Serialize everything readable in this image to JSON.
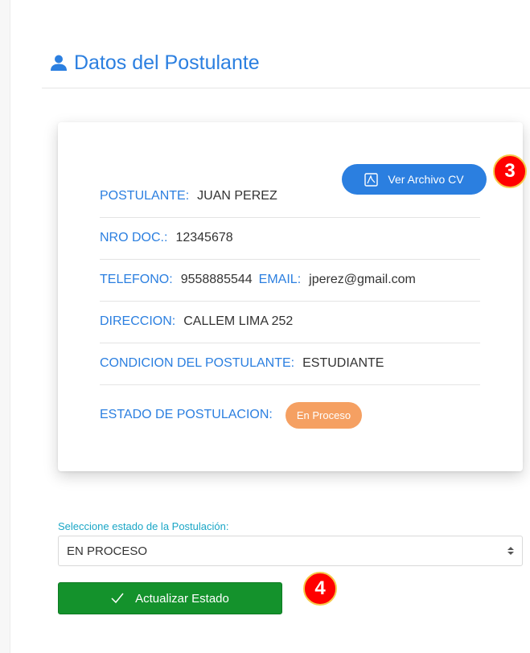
{
  "header": {
    "title": "Datos del Postulante",
    "icon": "user-icon"
  },
  "card": {
    "cv_button_label": "Ver Archivo CV",
    "cv_button_icon": "pdf-icon",
    "fields": {
      "postulante": {
        "label": "POSTULANTE:",
        "value": "JUAN PEREZ"
      },
      "nro_doc": {
        "label": "NRO DOC.:",
        "value": "12345678"
      },
      "telefono": {
        "label": "TELEFONO:",
        "value": "9558885544"
      },
      "email": {
        "label": "EMAIL:",
        "value": "jperez@gmail.com"
      },
      "direccion": {
        "label": "DIRECCION:",
        "value": "CALLEM LIMA 252"
      },
      "condicion": {
        "label": "CONDICION DEL POSTULANTE:",
        "value": "ESTUDIANTE"
      },
      "estado": {
        "label": "ESTADO DE POSTULACION:",
        "badge": "En Proceso"
      }
    }
  },
  "form": {
    "select_label": "Seleccione estado de la Postulación:",
    "select_value": "EN PROCESO",
    "submit_label": "Actualizar Estado",
    "submit_icon": "check-icon"
  },
  "annotations": {
    "marker_3": "3",
    "marker_4": "4"
  },
  "colors": {
    "accent_blue": "#2b7fe0",
    "badge_orange": "#f5a062",
    "button_green": "#14922c",
    "marker_red": "#ff0000"
  }
}
